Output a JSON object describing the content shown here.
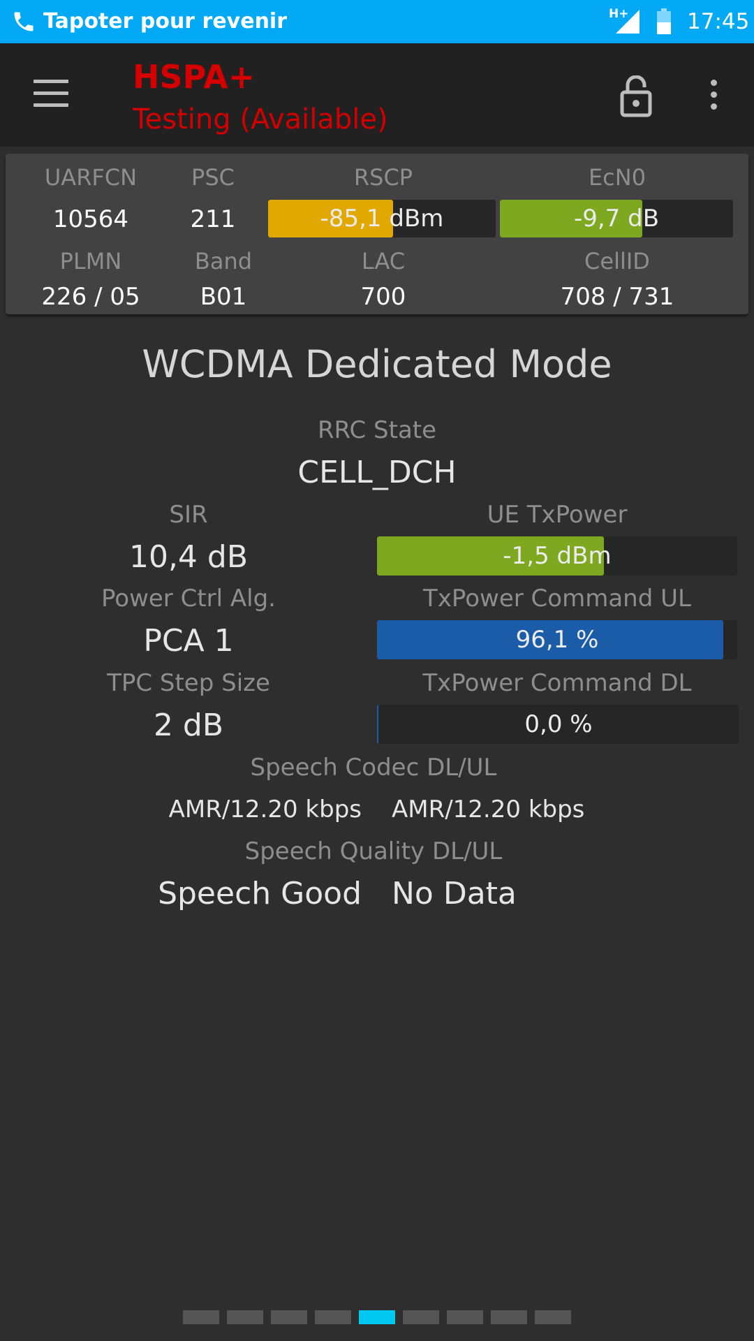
{
  "status_bar": {
    "notification": "Tapoter pour revenir",
    "network_type": "H+",
    "time": "17:45"
  },
  "app_bar": {
    "title": "HSPA+",
    "subtitle": "Testing (Available)"
  },
  "colors": {
    "status_bar_bg": "#03a9f4",
    "title_red": "#d40000",
    "rscp_bar": "#e0a800",
    "ecn0_bar": "#7fa821",
    "txpower_bar": "#7fa821",
    "tpc_ul_bar": "#1a5ca8",
    "page_active": "#00c8f0"
  },
  "cell_info": {
    "uarfcn_label": "UARFCN",
    "uarfcn": "10564",
    "psc_label": "PSC",
    "psc": "211",
    "rscp_label": "RSCP",
    "rscp": "-85,1 dBm",
    "rscp_fill": 0.55,
    "ecn0_label": "EcN0",
    "ecn0": "-9,7 dB",
    "ecn0_fill": 0.61,
    "plmn_label": "PLMN",
    "plmn": "226 / 05",
    "band_label": "Band",
    "band": "B01",
    "lac_label": "LAC",
    "lac": "700",
    "cellid_label": "CellID",
    "cellid": "708 / 731"
  },
  "main": {
    "mode_title": "WCDMA Dedicated Mode",
    "rrc_state_label": "RRC State",
    "rrc_state": "CELL_DCH",
    "sir_label": "SIR",
    "sir": "10,4 dB",
    "ue_txpower_label": "UE TxPower",
    "ue_txpower": "-1,5 dBm",
    "ue_txpower_fill": 0.63,
    "power_ctrl_label": "Power Ctrl Alg.",
    "power_ctrl": "PCA 1",
    "txpower_cmd_ul_label": "TxPower Command UL",
    "txpower_cmd_ul": "96,1 %",
    "txpower_cmd_ul_fill": 0.961,
    "tpc_step_label": "TPC Step Size",
    "tpc_step": "2 dB",
    "txpower_cmd_dl_label": "TxPower Command DL",
    "txpower_cmd_dl": "0,0 %",
    "txpower_cmd_dl_fill": 0.0,
    "speech_codec_label": "Speech Codec DL/UL",
    "speech_codec_dl": "AMR/12.20 kbps",
    "speech_codec_ul": "AMR/12.20 kbps",
    "speech_quality_label": "Speech Quality DL/UL",
    "speech_quality_dl": "Speech Good",
    "speech_quality_ul": "No Data"
  },
  "pager": {
    "count": 9,
    "active_index": 4
  }
}
